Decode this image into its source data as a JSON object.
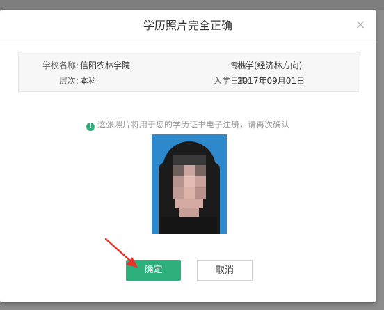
{
  "dialog": {
    "title": "学历照片完全正确",
    "close_icon": "×"
  },
  "info": {
    "school_label": "学校名称:",
    "school_value": "信阳农林学院",
    "major_label": "专业:",
    "major_value": "林学(经济林方向)",
    "level_label": "层次:",
    "level_value": "本科",
    "enroll_label": "入学日期:",
    "enroll_value": "2017年09月01日"
  },
  "notice": {
    "icon": "!",
    "text": "这张照片将用于您的学历证书电子注册，请再次确认"
  },
  "buttons": {
    "confirm": "确定",
    "cancel": "取消"
  },
  "colors": {
    "accent": "#2db07b",
    "photo_bg": "#2e88cc",
    "arrow": "#e8302a"
  }
}
